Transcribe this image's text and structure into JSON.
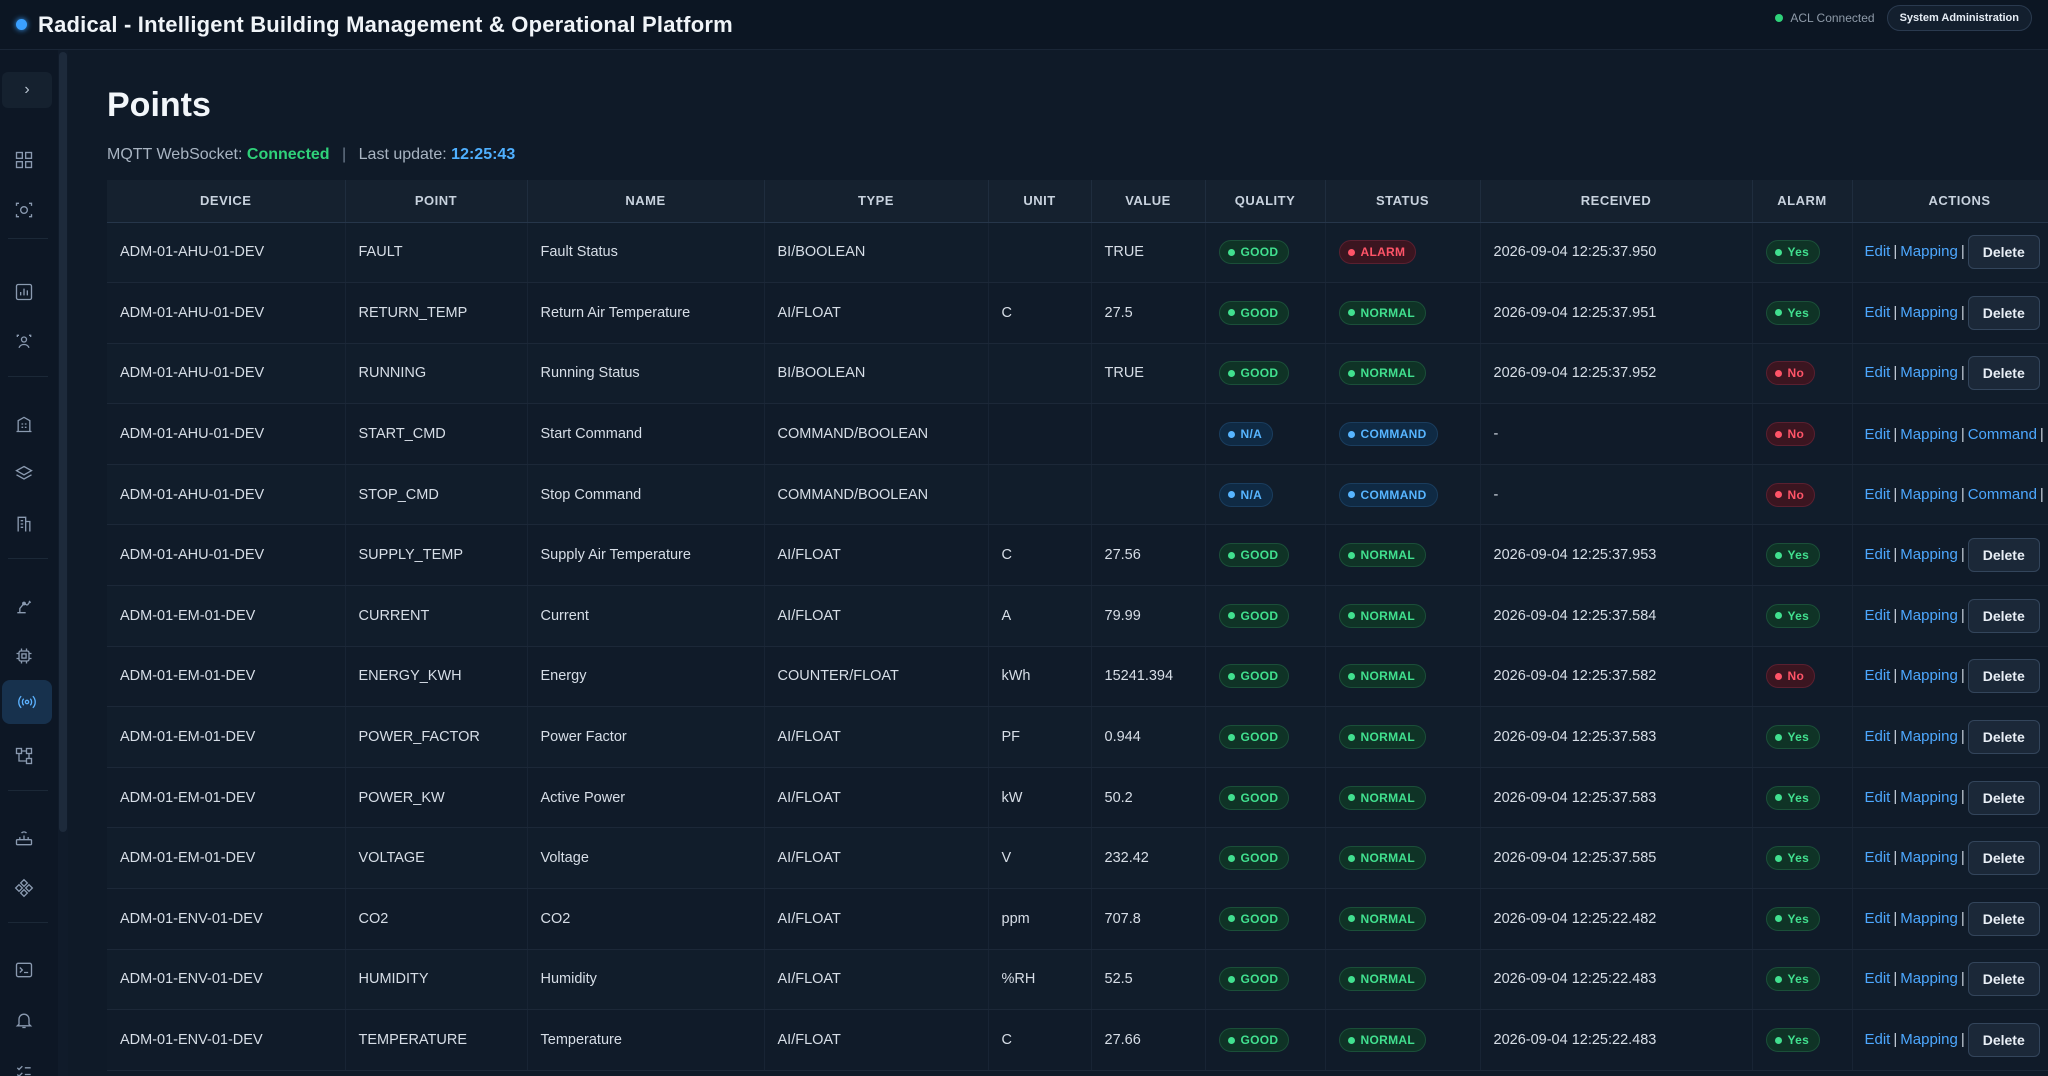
{
  "app": {
    "title": "Radical - Intelligent Building Management & Operational Platform",
    "acl_status": "ACL Connected",
    "sysadmin_label": "System Administration"
  },
  "sidebar": {
    "expand_icon": "chevron-right-icon",
    "icons": [
      {
        "name": "dashboard-icon",
        "active": false
      },
      {
        "name": "camera-scan-icon",
        "active": false
      },
      {
        "name": "analytics-icon",
        "active": false
      },
      {
        "name": "people-icon",
        "active": false
      },
      {
        "name": "building-icon",
        "active": false
      },
      {
        "name": "layers-icon",
        "active": false
      },
      {
        "name": "floor-icon",
        "active": false
      },
      {
        "name": "robot-arm-icon",
        "active": false
      },
      {
        "name": "chip-icon",
        "active": false
      },
      {
        "name": "broadcast-icon",
        "active": true
      },
      {
        "name": "hierarchy-icon",
        "active": false
      },
      {
        "name": "router-icon",
        "active": false
      },
      {
        "name": "network-icon",
        "active": false
      },
      {
        "name": "terminal-icon",
        "active": false
      },
      {
        "name": "bell-icon",
        "active": false
      },
      {
        "name": "checklist-icon",
        "active": false
      }
    ]
  },
  "page": {
    "title": "Points",
    "ws_label": "MQTT WebSocket:",
    "ws_status": "Connected",
    "separator": "|",
    "last_update_label": "Last update:",
    "last_update_time": "12:25:43"
  },
  "table": {
    "columns": [
      "DEVICE",
      "POINT",
      "NAME",
      "TYPE",
      "UNIT",
      "VALUE",
      "QUALITY",
      "STATUS",
      "RECEIVED",
      "ALARM",
      "ACTIONS"
    ],
    "action_labels": {
      "edit": "Edit",
      "mapping": "Mapping",
      "delete": "Delete",
      "command": "Command",
      "pipe": "|"
    },
    "rows": [
      {
        "device": "ADM-01-AHU-01-DEV",
        "point": "FAULT",
        "name": "Fault Status",
        "type": "BI/BOOLEAN",
        "unit": "",
        "value": "TRUE",
        "quality": "GOOD",
        "status": "ALARM",
        "received": "2026-09-04 12:25:37.950",
        "alarm": "Yes",
        "action": "delete"
      },
      {
        "device": "ADM-01-AHU-01-DEV",
        "point": "RETURN_TEMP",
        "name": "Return Air Temperature",
        "type": "AI/FLOAT",
        "unit": "C",
        "value": "27.5",
        "quality": "GOOD",
        "status": "NORMAL",
        "received": "2026-09-04 12:25:37.951",
        "alarm": "Yes",
        "action": "delete"
      },
      {
        "device": "ADM-01-AHU-01-DEV",
        "point": "RUNNING",
        "name": "Running Status",
        "type": "BI/BOOLEAN",
        "unit": "",
        "value": "TRUE",
        "quality": "GOOD",
        "status": "NORMAL",
        "received": "2026-09-04 12:25:37.952",
        "alarm": "No",
        "action": "delete"
      },
      {
        "device": "ADM-01-AHU-01-DEV",
        "point": "START_CMD",
        "name": "Start Command",
        "type": "COMMAND/BOOLEAN",
        "unit": "",
        "value": "",
        "quality": "N/A",
        "status": "COMMAND",
        "received": "-",
        "alarm": "No",
        "action": "command"
      },
      {
        "device": "ADM-01-AHU-01-DEV",
        "point": "STOP_CMD",
        "name": "Stop Command",
        "type": "COMMAND/BOOLEAN",
        "unit": "",
        "value": "",
        "quality": "N/A",
        "status": "COMMAND",
        "received": "-",
        "alarm": "No",
        "action": "command"
      },
      {
        "device": "ADM-01-AHU-01-DEV",
        "point": "SUPPLY_TEMP",
        "name": "Supply Air Temperature",
        "type": "AI/FLOAT",
        "unit": "C",
        "value": "27.56",
        "quality": "GOOD",
        "status": "NORMAL",
        "received": "2026-09-04 12:25:37.953",
        "alarm": "Yes",
        "action": "delete"
      },
      {
        "device": "ADM-01-EM-01-DEV",
        "point": "CURRENT",
        "name": "Current",
        "type": "AI/FLOAT",
        "unit": "A",
        "value": "79.99",
        "quality": "GOOD",
        "status": "NORMAL",
        "received": "2026-09-04 12:25:37.584",
        "alarm": "Yes",
        "action": "delete"
      },
      {
        "device": "ADM-01-EM-01-DEV",
        "point": "ENERGY_KWH",
        "name": "Energy",
        "type": "COUNTER/FLOAT",
        "unit": "kWh",
        "value": "15241.394",
        "quality": "GOOD",
        "status": "NORMAL",
        "received": "2026-09-04 12:25:37.582",
        "alarm": "No",
        "action": "delete"
      },
      {
        "device": "ADM-01-EM-01-DEV",
        "point": "POWER_FACTOR",
        "name": "Power Factor",
        "type": "AI/FLOAT",
        "unit": "PF",
        "value": "0.944",
        "quality": "GOOD",
        "status": "NORMAL",
        "received": "2026-09-04 12:25:37.583",
        "alarm": "Yes",
        "action": "delete"
      },
      {
        "device": "ADM-01-EM-01-DEV",
        "point": "POWER_KW",
        "name": "Active Power",
        "type": "AI/FLOAT",
        "unit": "kW",
        "value": "50.2",
        "quality": "GOOD",
        "status": "NORMAL",
        "received": "2026-09-04 12:25:37.583",
        "alarm": "Yes",
        "action": "delete"
      },
      {
        "device": "ADM-01-EM-01-DEV",
        "point": "VOLTAGE",
        "name": "Voltage",
        "type": "AI/FLOAT",
        "unit": "V",
        "value": "232.42",
        "quality": "GOOD",
        "status": "NORMAL",
        "received": "2026-09-04 12:25:37.585",
        "alarm": "Yes",
        "action": "delete"
      },
      {
        "device": "ADM-01-ENV-01-DEV",
        "point": "CO2",
        "name": "CO2",
        "type": "AI/FLOAT",
        "unit": "ppm",
        "value": "707.8",
        "quality": "GOOD",
        "status": "NORMAL",
        "received": "2026-09-04 12:25:22.482",
        "alarm": "Yes",
        "action": "delete"
      },
      {
        "device": "ADM-01-ENV-01-DEV",
        "point": "HUMIDITY",
        "name": "Humidity",
        "type": "AI/FLOAT",
        "unit": "%RH",
        "value": "52.5",
        "quality": "GOOD",
        "status": "NORMAL",
        "received": "2026-09-04 12:25:22.483",
        "alarm": "Yes",
        "action": "delete"
      },
      {
        "device": "ADM-01-ENV-01-DEV",
        "point": "TEMPERATURE",
        "name": "Temperature",
        "type": "AI/FLOAT",
        "unit": "C",
        "value": "27.66",
        "quality": "GOOD",
        "status": "NORMAL",
        "received": "2026-09-04 12:25:22.483",
        "alarm": "Yes",
        "action": "delete"
      }
    ]
  },
  "colors": {
    "background": "#0f1a28",
    "good": "#41e08f",
    "alarm": "#ff5468",
    "info": "#57b5ff",
    "link": "#4da8ff"
  }
}
